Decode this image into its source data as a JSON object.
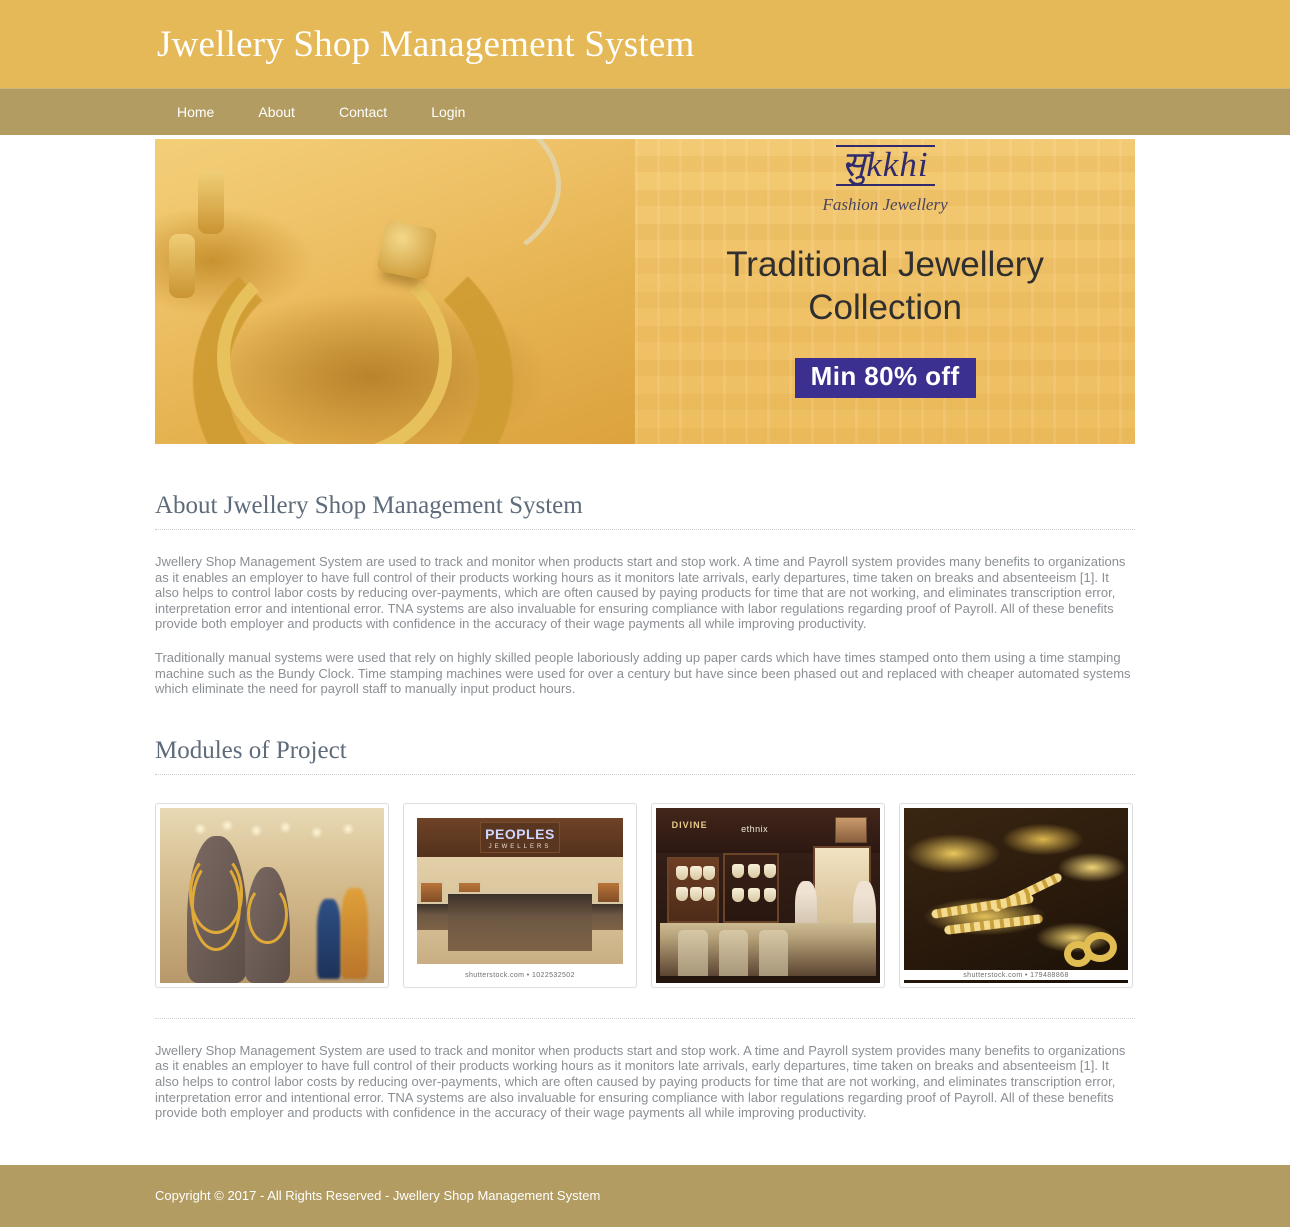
{
  "site": {
    "title": "Jwellery Shop Management System"
  },
  "nav": {
    "items": [
      {
        "label": "Home"
      },
      {
        "label": "About"
      },
      {
        "label": "Contact"
      },
      {
        "label": "Login"
      }
    ]
  },
  "banner": {
    "brand_logo": "सुkkhi",
    "brand_subtitle": "Fashion Jewellery",
    "headline_line1": "Traditional Jewellery",
    "headline_line2": "Collection",
    "offer_badge": "Min 80% off",
    "left_image_alt": "Gold kundan necklace and earrings set on yellow fabric",
    "badge_color": "#3b2f8f",
    "background_color": "#efc069"
  },
  "about": {
    "heading": "About Jwellery Shop Management System",
    "paragraph1": "Jwellery Shop Management System are used to track and monitor when products start and stop work. A time and Payroll system provides many benefits to organizations as it enables an employer to have full control of their products working hours as it monitors late arrivals, early departures, time taken on breaks and absenteeism [1]. It also helps to control labor costs by reducing over-payments, which are often caused by paying products for time that are not working, and eliminates transcription error, interpretation error and intentional error. TNA systems are also invaluable for ensuring compliance with labor regulations regarding proof of Payroll. All of these benefits provide both employer and products with confidence in the accuracy of their wage payments all while improving productivity.",
    "paragraph2": "Traditionally manual systems were used that rely on highly skilled people laboriously adding up paper cards which have times stamped onto them using a time stamping machine such as the Bundy Clock. Time stamping machines were used for over a century but have since been phased out and replaced with cheaper automated systems which eliminate the need for payroll staff to manually input product hours."
  },
  "modules": {
    "heading": "Modules of Project",
    "cards": [
      {
        "alt": "Jewellery showroom display with gold necklaces on busts",
        "caption": ""
      },
      {
        "alt": "Peoples Jewellers store interior with display counters",
        "caption": "shutterstock.com • 1022532502",
        "sign_brand": "PEOPLES",
        "sign_sub": "JEWELLERS"
      },
      {
        "alt": "Divine ethnix jewellery showroom with wall displays",
        "caption": "",
        "sign_brand": "DIVINE",
        "sign_sub": "ethnix"
      },
      {
        "alt": "Assorted gold jewellery on a display table",
        "caption": "shutterstock.com • 179488868"
      }
    ]
  },
  "bottom": {
    "paragraph": "Jwellery Shop Management System are used to track and monitor when products start and stop work. A time and Payroll system provides many benefits to organizations as it enables an employer to have full control of their products working hours as it monitors late arrivals, early departures, time taken on breaks and absenteeism [1]. It also helps to control labor costs by reducing over-payments, which are often caused by paying products for time that are not working, and eliminates transcription error, interpretation error and intentional error. TNA systems are also invaluable for ensuring compliance with labor regulations regarding proof of Payroll. All of these benefits provide both employer and products with confidence in the accuracy of their wage payments all while improving productivity."
  },
  "footer": {
    "copyright": "Copyright © 2017 - All Rights Reserved - Jwellery Shop Management System"
  },
  "theme": {
    "header_color": "#e5b958",
    "nav_color": "#b29c62",
    "text_color": "#8a8f94",
    "heading_color": "#5e6b7a"
  }
}
